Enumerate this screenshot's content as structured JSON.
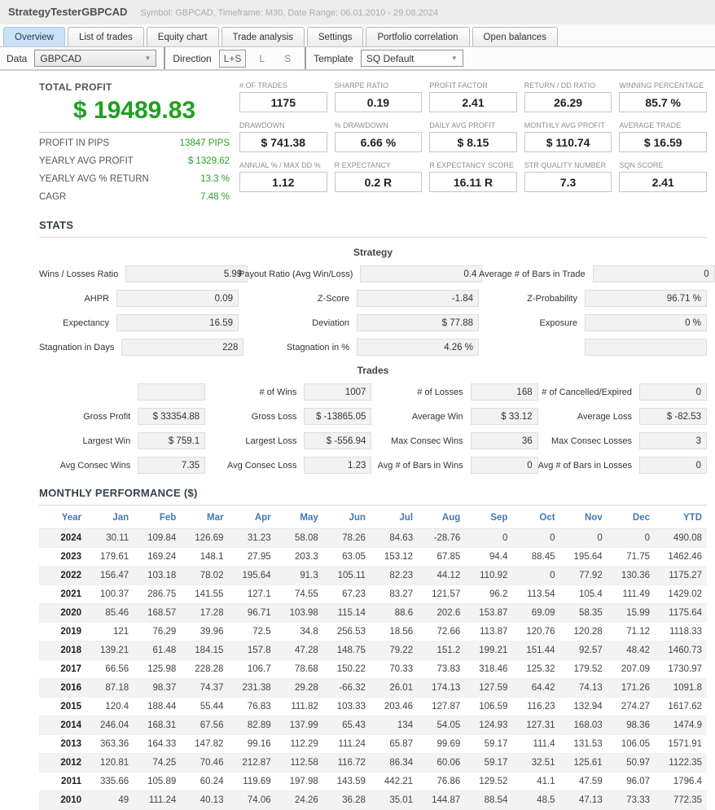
{
  "header": {
    "title": "StrategyTesterGBPCAD",
    "subtitle": "Symbol: GBPCAD, Timeframe: M30, Date Range: 06.01.2010 - 29.08.2024"
  },
  "tabs": [
    {
      "label": "Overview",
      "active": true
    },
    {
      "label": "List of trades",
      "active": false
    },
    {
      "label": "Equity chart",
      "active": false
    },
    {
      "label": "Trade analysis",
      "active": false
    },
    {
      "label": "Settings",
      "active": false
    },
    {
      "label": "Portfolio correlation",
      "active": false
    },
    {
      "label": "Open balances",
      "active": false
    }
  ],
  "toolbar": {
    "data_label": "Data",
    "data_value": "GBPCAD",
    "direction_label": "Direction",
    "direction_options": [
      {
        "label": "L+S",
        "selected": true
      },
      {
        "label": "L",
        "selected": false
      },
      {
        "label": "S",
        "selected": false
      }
    ],
    "template_label": "Template",
    "template_value": "SQ Default",
    "dropdown_arrow_icon": "▼"
  },
  "total_profit": {
    "label": "TOTAL PROFIT",
    "value": "$ 19489.83",
    "details": [
      {
        "label": "PROFIT IN PIPS",
        "value": "13847 PIPS"
      },
      {
        "label": "YEARLY AVG PROFIT",
        "value": "$ 1329.62"
      },
      {
        "label": "YEARLY AVG % RETURN",
        "value": "13.3 %"
      },
      {
        "label": "CAGR",
        "value": "7.48 %"
      }
    ]
  },
  "metrics": [
    {
      "label": "# OF TRADES",
      "value": "1175"
    },
    {
      "label": "SHARPE RATIO",
      "value": "0.19"
    },
    {
      "label": "PROFIT FACTOR",
      "value": "2.41"
    },
    {
      "label": "RETURN / DD RATIO",
      "value": "26.29"
    },
    {
      "label": "WINNING PERCENTAGE",
      "value": "85.7 %"
    },
    {
      "label": "DRAWDOWN",
      "value": "$ 741.38"
    },
    {
      "label": "% DRAWDOWN",
      "value": "6.66 %"
    },
    {
      "label": "DAILY AVG PROFIT",
      "value": "$ 8.15"
    },
    {
      "label": "MONTHLY AVG PROFIT",
      "value": "$ 110.74"
    },
    {
      "label": "AVERAGE TRADE",
      "value": "$ 16.59"
    },
    {
      "label": "ANNUAL % / MAX DD %",
      "value": "1.12"
    },
    {
      "label": "R EXPECTANCY",
      "value": "0.2 R"
    },
    {
      "label": "R EXPECTANCY SCORE",
      "value": "16.11 R"
    },
    {
      "label": "STR QUALITY NUMBER",
      "value": "7.3"
    },
    {
      "label": "SQN SCORE",
      "value": "2.41"
    }
  ],
  "stats": {
    "title": "STATS",
    "strategy": {
      "title": "Strategy",
      "rows": [
        [
          {
            "label": "Wins / Losses Ratio",
            "value": "5.99"
          },
          {
            "label": "Payout Ratio (Avg Win/Loss)",
            "value": "0.4"
          },
          {
            "label": "Average # of Bars in Trade",
            "value": "0"
          }
        ],
        [
          {
            "label": "AHPR",
            "value": "0.09"
          },
          {
            "label": "Z-Score",
            "value": "-1.84"
          },
          {
            "label": "Z-Probability",
            "value": "96.71 %"
          }
        ],
        [
          {
            "label": "Expectancy",
            "value": "16.59"
          },
          {
            "label": "Deviation",
            "value": "$ 77.88"
          },
          {
            "label": "Exposure",
            "value": "0 %"
          }
        ],
        [
          {
            "label": "Stagnation in Days",
            "value": "228"
          },
          {
            "label": "Stagnation in %",
            "value": "4.26 %"
          },
          {
            "label": "",
            "value": ""
          }
        ]
      ]
    },
    "trades": {
      "title": "Trades",
      "rows": [
        [
          {
            "label": "",
            "value": ""
          },
          {
            "label": "# of Wins",
            "value": "1007"
          },
          {
            "label": "# of Losses",
            "value": "168"
          },
          {
            "label": "# of Cancelled/Expired",
            "value": "0"
          }
        ],
        [
          {
            "label": "Gross Profit",
            "value": "$ 33354.88"
          },
          {
            "label": "Gross Loss",
            "value": "$ -13865.05"
          },
          {
            "label": "Average Win",
            "value": "$ 33.12"
          },
          {
            "label": "Average Loss",
            "value": "$ -82.53"
          }
        ],
        [
          {
            "label": "Largest Win",
            "value": "$ 759.1"
          },
          {
            "label": "Largest Loss",
            "value": "$ -556.94"
          },
          {
            "label": "Max Consec Wins",
            "value": "36"
          },
          {
            "label": "Max Consec Losses",
            "value": "3"
          }
        ],
        [
          {
            "label": "Avg Consec Wins",
            "value": "7.35"
          },
          {
            "label": "Avg Consec Loss",
            "value": "1.23"
          },
          {
            "label": "Avg # of Bars in Wins",
            "value": "0"
          },
          {
            "label": "Avg # of Bars in Losses",
            "value": "0"
          }
        ]
      ]
    }
  },
  "monthly": {
    "title": "MONTHLY PERFORMANCE ($)",
    "columns": [
      "Year",
      "Jan",
      "Feb",
      "Mar",
      "Apr",
      "May",
      "Jun",
      "Jul",
      "Aug",
      "Sep",
      "Oct",
      "Nov",
      "Dec",
      "YTD"
    ],
    "rows": [
      {
        "year": "2024",
        "values": [
          "30.11",
          "109.84",
          "126.69",
          "31.23",
          "58.08",
          "78.26",
          "84.63",
          "-28.76",
          "0",
          "0",
          "0",
          "0",
          "490.08"
        ]
      },
      {
        "year": "2023",
        "values": [
          "179.61",
          "169.24",
          "148.1",
          "27.95",
          "203.3",
          "63.05",
          "153.12",
          "67.85",
          "94.4",
          "88.45",
          "195.64",
          "71.75",
          "1462.46"
        ]
      },
      {
        "year": "2022",
        "values": [
          "156.47",
          "103.18",
          "78.02",
          "195.64",
          "91.3",
          "105.11",
          "82.23",
          "44.12",
          "110.92",
          "0",
          "77.92",
          "130.36",
          "1175.27"
        ]
      },
      {
        "year": "2021",
        "values": [
          "100.37",
          "286.75",
          "141.55",
          "127.1",
          "74.55",
          "67.23",
          "83.27",
          "121.57",
          "96.2",
          "113.54",
          "105.4",
          "111.49",
          "1429.02"
        ]
      },
      {
        "year": "2020",
        "values": [
          "85.46",
          "168.57",
          "17.28",
          "96.71",
          "103.98",
          "115.14",
          "88.6",
          "202.6",
          "153.87",
          "69.09",
          "58.35",
          "15.99",
          "1175.64"
        ]
      },
      {
        "year": "2019",
        "values": [
          "121",
          "76.29",
          "39.96",
          "72.5",
          "34.8",
          "256.53",
          "18.56",
          "72.66",
          "113.87",
          "120.76",
          "120.28",
          "71.12",
          "1118.33"
        ]
      },
      {
        "year": "2018",
        "values": [
          "139.21",
          "61.48",
          "184.15",
          "157.8",
          "47.28",
          "148.75",
          "79.22",
          "151.2",
          "199.21",
          "151.44",
          "92.57",
          "48.42",
          "1460.73"
        ]
      },
      {
        "year": "2017",
        "values": [
          "66.56",
          "125.98",
          "228.28",
          "106.7",
          "78.68",
          "150.22",
          "70.33",
          "73.83",
          "318.46",
          "125.32",
          "179.52",
          "207.09",
          "1730.97"
        ]
      },
      {
        "year": "2016",
        "values": [
          "87.18",
          "98.37",
          "74.37",
          "231.38",
          "29.28",
          "-66.32",
          "26.01",
          "174.13",
          "127.59",
          "64.42",
          "74.13",
          "171.26",
          "1091.8"
        ]
      },
      {
        "year": "2015",
        "values": [
          "120.4",
          "188.44",
          "55.44",
          "76.83",
          "111.82",
          "103.33",
          "203.46",
          "127.87",
          "106.59",
          "116.23",
          "132.94",
          "274.27",
          "1617.62"
        ]
      },
      {
        "year": "2014",
        "values": [
          "246.04",
          "168.31",
          "67.56",
          "82.89",
          "137.99",
          "65.43",
          "134",
          "54.05",
          "124.93",
          "127.31",
          "168.03",
          "98.36",
          "1474.9"
        ]
      },
      {
        "year": "2013",
        "values": [
          "363.36",
          "164.33",
          "147.82",
          "99.16",
          "112.29",
          "111.24",
          "65.87",
          "99.69",
          "59.17",
          "111.4",
          "131.53",
          "106.05",
          "1571.91"
        ]
      },
      {
        "year": "2012",
        "values": [
          "120.81",
          "74.25",
          "70.46",
          "212.87",
          "112.58",
          "116.72",
          "86.34",
          "60.06",
          "59.17",
          "32.51",
          "125.61",
          "50.97",
          "1122.35"
        ]
      },
      {
        "year": "2011",
        "values": [
          "335.66",
          "105.89",
          "60.24",
          "119.69",
          "197.98",
          "143.59",
          "442.21",
          "76.86",
          "129.52",
          "41.1",
          "47.59",
          "96.07",
          "1796.4"
        ]
      },
      {
        "year": "2010",
        "values": [
          "49",
          "111.24",
          "40.13",
          "74.06",
          "24.26",
          "36.28",
          "35.01",
          "144.87",
          "88.54",
          "48.5",
          "47.13",
          "73.33",
          "772.35"
        ]
      }
    ]
  },
  "colors": {
    "profit_green": "#1fa11f",
    "loss_red": "#e05c5c",
    "table_header_blue": "#4479b2",
    "active_tab_bg": "#c9e2f7"
  }
}
